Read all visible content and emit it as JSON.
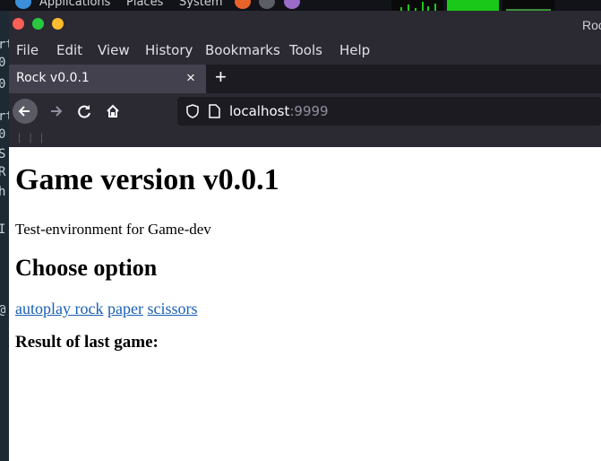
{
  "desktop": {
    "menus": [
      "Applications",
      "Places",
      "System"
    ],
    "terminal_chars": [
      "t",
      "rt",
      "0",
      "e",
      "0",
      "S",
      "R",
      "h",
      "I",
      "@"
    ]
  },
  "window": {
    "title": "Rock",
    "menu": [
      "File",
      "Edit",
      "View",
      "History",
      "Bookmarks",
      "Tools",
      "Help"
    ]
  },
  "tab": {
    "title": "Rock v0.0.1",
    "close": "×",
    "new_tab": "+"
  },
  "address": {
    "host": "localhost",
    "port": ":9999"
  },
  "bookmarks_toolbar": "| | |",
  "page": {
    "heading": "Game version v0.0.1",
    "subtitle": "Test-environment for Game-dev",
    "options_heading": "Choose option",
    "links": [
      "autoplay rock",
      "paper",
      "scissors"
    ],
    "result_heading": "Result of last game:"
  },
  "colors": {
    "link": "#1a5fb4",
    "close_dot": "#fe5f57",
    "min_dot": "#febc2e",
    "max_dot": "#28c840"
  }
}
